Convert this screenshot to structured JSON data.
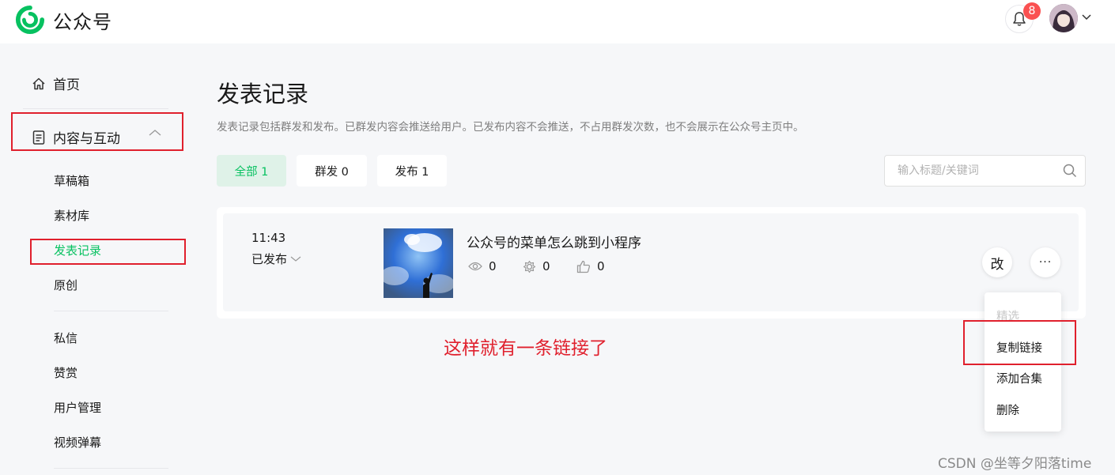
{
  "header": {
    "app_name": "公众号",
    "notification_count": "8"
  },
  "sidebar": {
    "home": "首页",
    "group_label": "内容与互动",
    "group_items": [
      "草稿箱",
      "素材库",
      "发表记录",
      "原创"
    ],
    "other_items": [
      "私信",
      "赞赏",
      "用户管理",
      "视频弹幕"
    ]
  },
  "main": {
    "title": "发表记录",
    "description": "发表记录包括群发和发布。已群发内容会推送给用户。已发布内容不会推送，不占用群发次数，也不会展示在公众号主页中。",
    "tabs": [
      {
        "label": "全部 1",
        "active": true
      },
      {
        "label": "群发 0",
        "active": false
      },
      {
        "label": "发布 1",
        "active": false
      }
    ],
    "search_placeholder": "输入标题/关键词"
  },
  "record": {
    "time": "11:43",
    "status": "已发布",
    "title": "公众号的菜单怎么跳到小程序",
    "views": "0",
    "shares": "0",
    "likes": "0",
    "edit_label": "改",
    "more_label": "···"
  },
  "menu": {
    "items": [
      "精选",
      "复制链接",
      "添加合集",
      "删除"
    ]
  },
  "annotation": "这样就有一条链接了",
  "watermark": "CSDN @坐等夕阳落time",
  "colors": {
    "accent": "#07c160",
    "annotation": "#e0202d",
    "badge": "#fa5151"
  }
}
